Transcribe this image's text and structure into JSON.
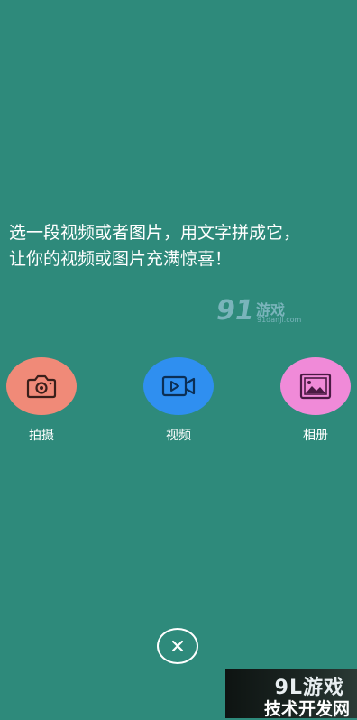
{
  "intro": {
    "line1": "选一段视频或者图片，用文字拼成它，",
    "line2": "让你的视频或图片充满惊喜！"
  },
  "watermark_mid": {
    "num": "91",
    "name": "游戏",
    "url": "91danji.com"
  },
  "actions": [
    {
      "label": "拍摄",
      "icon": "camera-icon",
      "color": "#f08a78"
    },
    {
      "label": "视频",
      "icon": "video-icon",
      "color": "#2f8ff0"
    },
    {
      "label": "相册",
      "icon": "image-icon",
      "color": "#f08ad8"
    }
  ],
  "close": {
    "icon": "close-icon"
  },
  "corner_watermark": {
    "top": "9L游戏",
    "bottom": "技术开发网"
  },
  "colors": {
    "background": "#2e8a7b"
  }
}
